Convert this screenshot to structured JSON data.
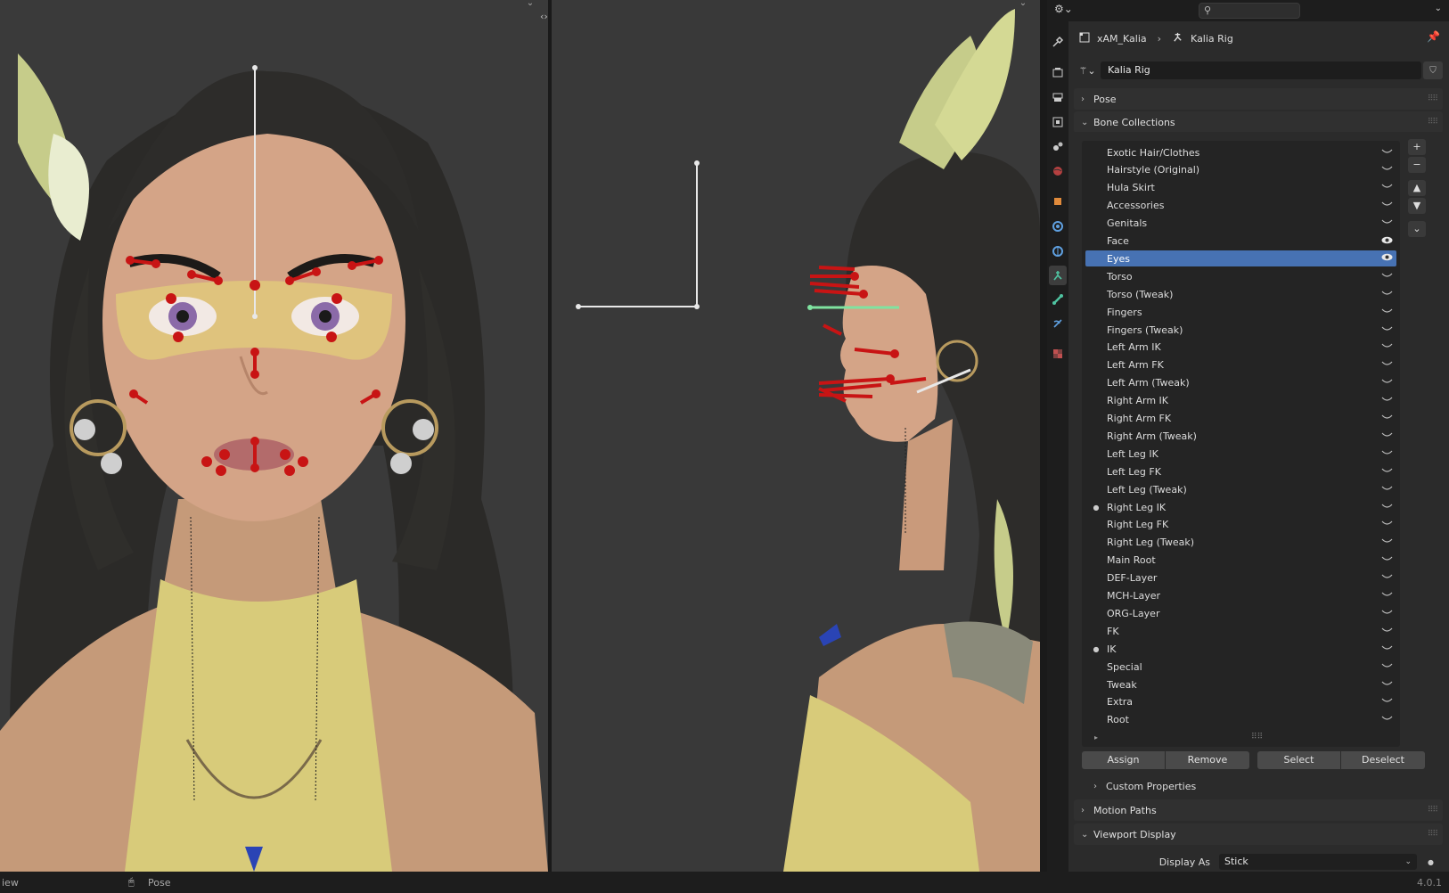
{
  "topbar": {
    "search_placeholder": ""
  },
  "breadcrumb": {
    "object": "xAM_Kalia",
    "armature": "Kalia Rig"
  },
  "datablock": {
    "name": "Kalia Rig"
  },
  "panels": {
    "pose": "Pose",
    "bone_collections": "Bone Collections",
    "custom_properties": "Custom Properties",
    "motion_paths": "Motion Paths",
    "viewport_display": "Viewport Display"
  },
  "collections": [
    {
      "label": "Exotic Hair/Clothes",
      "dot": false,
      "visible": false,
      "active": false
    },
    {
      "label": "Hairstyle (Original)",
      "dot": false,
      "visible": false,
      "active": false
    },
    {
      "label": "Hula Skirt",
      "dot": false,
      "visible": false,
      "active": false
    },
    {
      "label": "Accessories",
      "dot": false,
      "visible": false,
      "active": false
    },
    {
      "label": "Genitals",
      "dot": false,
      "visible": false,
      "active": false
    },
    {
      "label": "Face",
      "dot": false,
      "visible": true,
      "active": false
    },
    {
      "label": "Eyes",
      "dot": false,
      "visible": true,
      "active": true
    },
    {
      "label": "Torso",
      "dot": false,
      "visible": false,
      "active": false
    },
    {
      "label": "Torso (Tweak)",
      "dot": false,
      "visible": false,
      "active": false
    },
    {
      "label": "Fingers",
      "dot": false,
      "visible": false,
      "active": false
    },
    {
      "label": "Fingers (Tweak)",
      "dot": false,
      "visible": false,
      "active": false
    },
    {
      "label": "Left Arm IK",
      "dot": false,
      "visible": false,
      "active": false
    },
    {
      "label": "Left Arm FK",
      "dot": false,
      "visible": false,
      "active": false
    },
    {
      "label": "Left Arm (Tweak)",
      "dot": false,
      "visible": false,
      "active": false
    },
    {
      "label": "Right Arm IK",
      "dot": false,
      "visible": false,
      "active": false
    },
    {
      "label": "Right Arm FK",
      "dot": false,
      "visible": false,
      "active": false
    },
    {
      "label": "Right Arm (Tweak)",
      "dot": false,
      "visible": false,
      "active": false
    },
    {
      "label": "Left Leg IK",
      "dot": false,
      "visible": false,
      "active": false
    },
    {
      "label": "Left Leg FK",
      "dot": false,
      "visible": false,
      "active": false
    },
    {
      "label": "Left Leg (Tweak)",
      "dot": false,
      "visible": false,
      "active": false
    },
    {
      "label": "Right Leg IK",
      "dot": true,
      "visible": false,
      "active": false
    },
    {
      "label": "Right Leg FK",
      "dot": false,
      "visible": false,
      "active": false
    },
    {
      "label": "Right Leg (Tweak)",
      "dot": false,
      "visible": false,
      "active": false
    },
    {
      "label": "Main Root",
      "dot": false,
      "visible": false,
      "active": false
    },
    {
      "label": "DEF-Layer",
      "dot": false,
      "visible": false,
      "active": false
    },
    {
      "label": "MCH-Layer",
      "dot": false,
      "visible": false,
      "active": false
    },
    {
      "label": "ORG-Layer",
      "dot": false,
      "visible": false,
      "active": false
    },
    {
      "label": "FK",
      "dot": false,
      "visible": false,
      "active": false
    },
    {
      "label": "IK",
      "dot": true,
      "visible": false,
      "active": false
    },
    {
      "label": "Special",
      "dot": false,
      "visible": false,
      "active": false
    },
    {
      "label": "Tweak",
      "dot": false,
      "visible": false,
      "active": false
    },
    {
      "label": "Extra",
      "dot": false,
      "visible": false,
      "active": false
    },
    {
      "label": "Root",
      "dot": false,
      "visible": false,
      "active": false
    }
  ],
  "buttons": {
    "assign": "Assign",
    "remove": "Remove",
    "select": "Select",
    "deselect": "Deselect"
  },
  "display_as": {
    "label": "Display As",
    "value": "Stick"
  },
  "statusbar": {
    "left": "iew",
    "mode": "Pose",
    "version": "4.0.1"
  },
  "colors": {
    "accent": "#4772b3",
    "bone_red": "#c81414",
    "active_bone": "#7fe3a0"
  }
}
